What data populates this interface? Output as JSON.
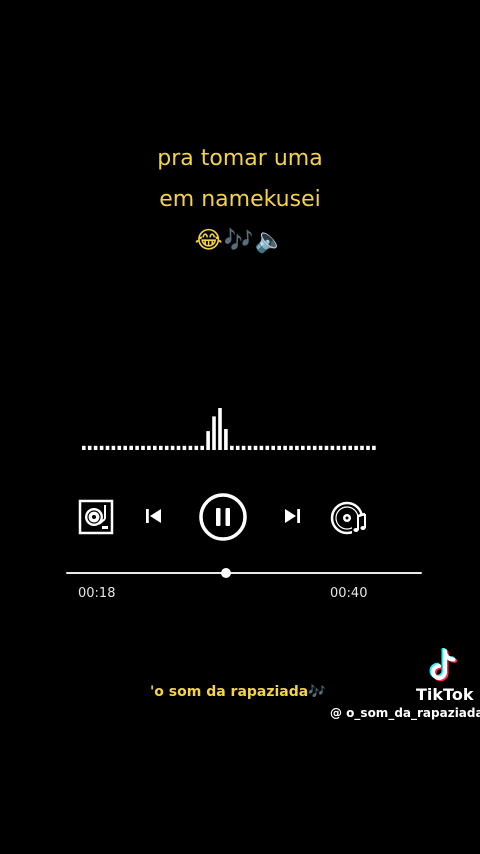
{
  "lyrics": {
    "line1": "pra tomar uma",
    "line2": "em namekusei",
    "emojis": "😂🎶🔈"
  },
  "player": {
    "current_time": "00:18",
    "total_time": "00:40",
    "progress": 0.45,
    "state": "playing",
    "icons": [
      "turntable-icon",
      "previous-icon",
      "pause-icon",
      "next-icon",
      "music-disc-icon"
    ]
  },
  "visualizer": {
    "bar_levels": [
      0.1,
      0.1,
      0.1,
      0.1,
      0.1,
      0.1,
      0.1,
      0.1,
      0.1,
      0.1,
      0.1,
      0.1,
      0.1,
      0.1,
      0.1,
      0.1,
      0.1,
      0.1,
      0.1,
      0.1,
      0.1,
      0.45,
      0.8,
      1.0,
      0.5,
      0.1,
      0.1,
      0.1,
      0.1,
      0.1,
      0.1,
      0.1,
      0.1,
      0.1,
      0.1,
      0.1,
      0.1,
      0.1,
      0.1,
      0.1,
      0.1,
      0.1,
      0.1,
      0.1,
      0.1,
      0.1,
      0.1,
      0.1,
      0.1,
      0.1
    ],
    "color": "#ffffff"
  },
  "caption": "'o som da rapaziada🎶",
  "watermark": {
    "brand": "TikTok",
    "handle": "@ o_som_da_rapaziada"
  },
  "colors": {
    "background": "#000000",
    "lyric": "#f3d34a",
    "tiktok_cyan": "#25f4ee",
    "tiktok_red": "#fe2c55"
  }
}
